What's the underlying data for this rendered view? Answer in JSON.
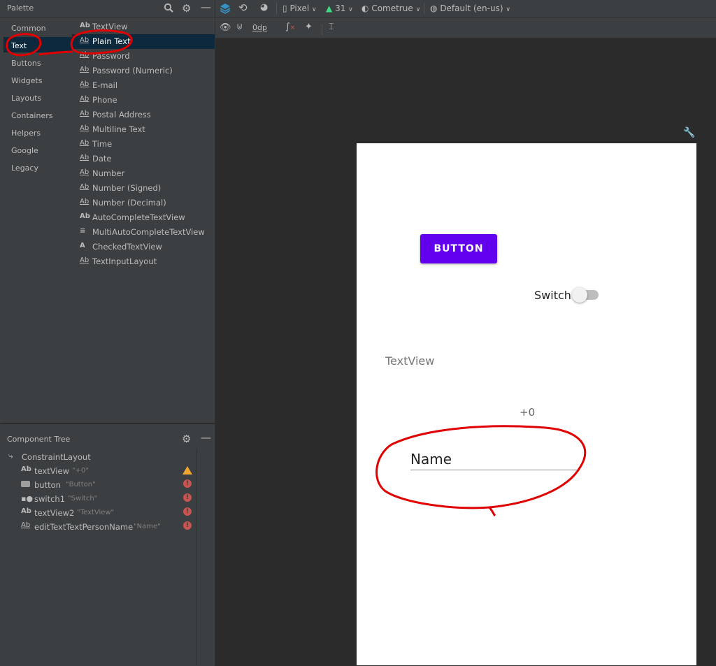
{
  "palette": {
    "title": "Palette",
    "categories": [
      "Common",
      "Text",
      "Buttons",
      "Widgets",
      "Layouts",
      "Containers",
      "Helpers",
      "Google",
      "Legacy"
    ],
    "selected_category": "Text",
    "widgets": [
      {
        "icon": "Ab",
        "label": "TextView"
      },
      {
        "icon": "Ab",
        "label": "Plain Text"
      },
      {
        "icon": "Ab",
        "label": "Password"
      },
      {
        "icon": "Ab",
        "label": "Password (Numeric)"
      },
      {
        "icon": "Ab",
        "label": "E-mail"
      },
      {
        "icon": "Ab",
        "label": "Phone"
      },
      {
        "icon": "Ab",
        "label": "Postal Address"
      },
      {
        "icon": "Ab",
        "label": "Multiline Text"
      },
      {
        "icon": "Ab",
        "label": "Time"
      },
      {
        "icon": "Ab",
        "label": "Date"
      },
      {
        "icon": "Ab",
        "label": "Number"
      },
      {
        "icon": "Ab",
        "label": "Number (Signed)"
      },
      {
        "icon": "Ab",
        "label": "Number (Decimal)"
      },
      {
        "icon": "Ab",
        "label": "AutoCompleteTextView"
      },
      {
        "icon": "≡",
        "label": "MultiAutoCompleteTextView"
      },
      {
        "icon": "A",
        "label": "CheckedTextView"
      },
      {
        "icon": "Ab",
        "label": "TextInputLayout"
      }
    ],
    "selected_widget": "Plain Text"
  },
  "component_tree": {
    "title": "Component Tree",
    "root": "ConstraintLayout",
    "items": [
      {
        "icon": "Ab",
        "name": "textView",
        "value": "\"+0\"",
        "status": "warning"
      },
      {
        "icon": "button-icon",
        "name": "button",
        "value": "\"Button\"",
        "status": "error"
      },
      {
        "icon": "switch-icon",
        "name": "switch1",
        "value": "\"Switch\"",
        "status": "error"
      },
      {
        "icon": "Ab",
        "name": "textView2",
        "value": "\"TextView\"",
        "status": "error"
      },
      {
        "icon": "Ab",
        "name": "editTextTextPersonName",
        "value": "\"Name\"",
        "status": "error"
      }
    ]
  },
  "toolbar": {
    "device": "Pixel",
    "api": "31",
    "theme": "Cometrue",
    "locale": "Default (en-us)",
    "margin": "0dp"
  },
  "device_preview": {
    "button_text": "BUTTON",
    "switch_label": "Switch",
    "textview2_text": "TextView",
    "textview_text": "+0",
    "edittext_text": "Name"
  },
  "colors": {
    "accent": "#6200ee",
    "annotation": "#e00000",
    "selection": "#0d293e"
  }
}
